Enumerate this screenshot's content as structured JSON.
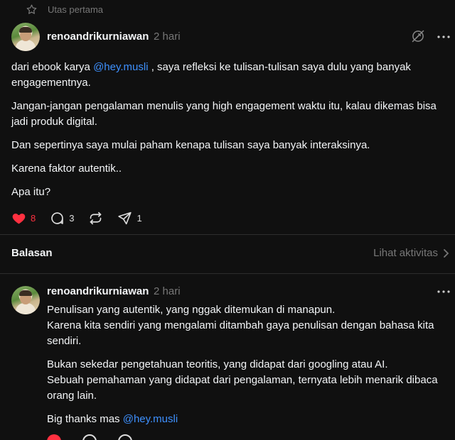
{
  "pinned": {
    "label": "Utas pertama",
    "icon": "star-icon"
  },
  "post": {
    "username": "renoandrikurniawan",
    "time": "2 hari",
    "paragraphs": [
      {
        "before": "dari ebook karya ",
        "mention": "@hey.musli",
        "after": " , saya refleksi ke tulisan-tulisan saya dulu yang banyak engagementnya."
      },
      {
        "text": "Jangan-jangan pengalaman menulis yang high engagement waktu itu, kalau dikemas bisa jadi produk digital."
      },
      {
        "text": "Dan sepertinya saya mulai paham kenapa tulisan saya banyak interaksinya."
      },
      {
        "text": "Karena faktor autentik.."
      },
      {
        "text": "Apa itu?"
      }
    ],
    "likes": "8",
    "comments": "3",
    "shares": "1",
    "like_color": "#ff3040"
  },
  "replies": {
    "title": "Balasan",
    "activity_link": "Lihat aktivitas"
  },
  "reply": {
    "username": "renoandrikurniawan",
    "time": "2 hari",
    "p1_line1": "Penulisan yang autentik, yang nggak ditemukan di manapun.",
    "p1_line2": "Karena kita sendiri yang mengalami ditambah gaya penulisan dengan bahasa kita sendiri.",
    "p2_line1": "Bukan sekedar pengetahuan teoritis, yang didapat dari googling atau AI.",
    "p2_line2": "Sebuah pemahaman yang didapat dari pengalaman, ternyata lebih menarik dibaca orang lain.",
    "p3_before": "Big thanks mas ",
    "p3_mention": "@hey.musli"
  },
  "colors": {
    "background": "#101010",
    "mention": "#3e91ff",
    "muted": "#777777"
  }
}
